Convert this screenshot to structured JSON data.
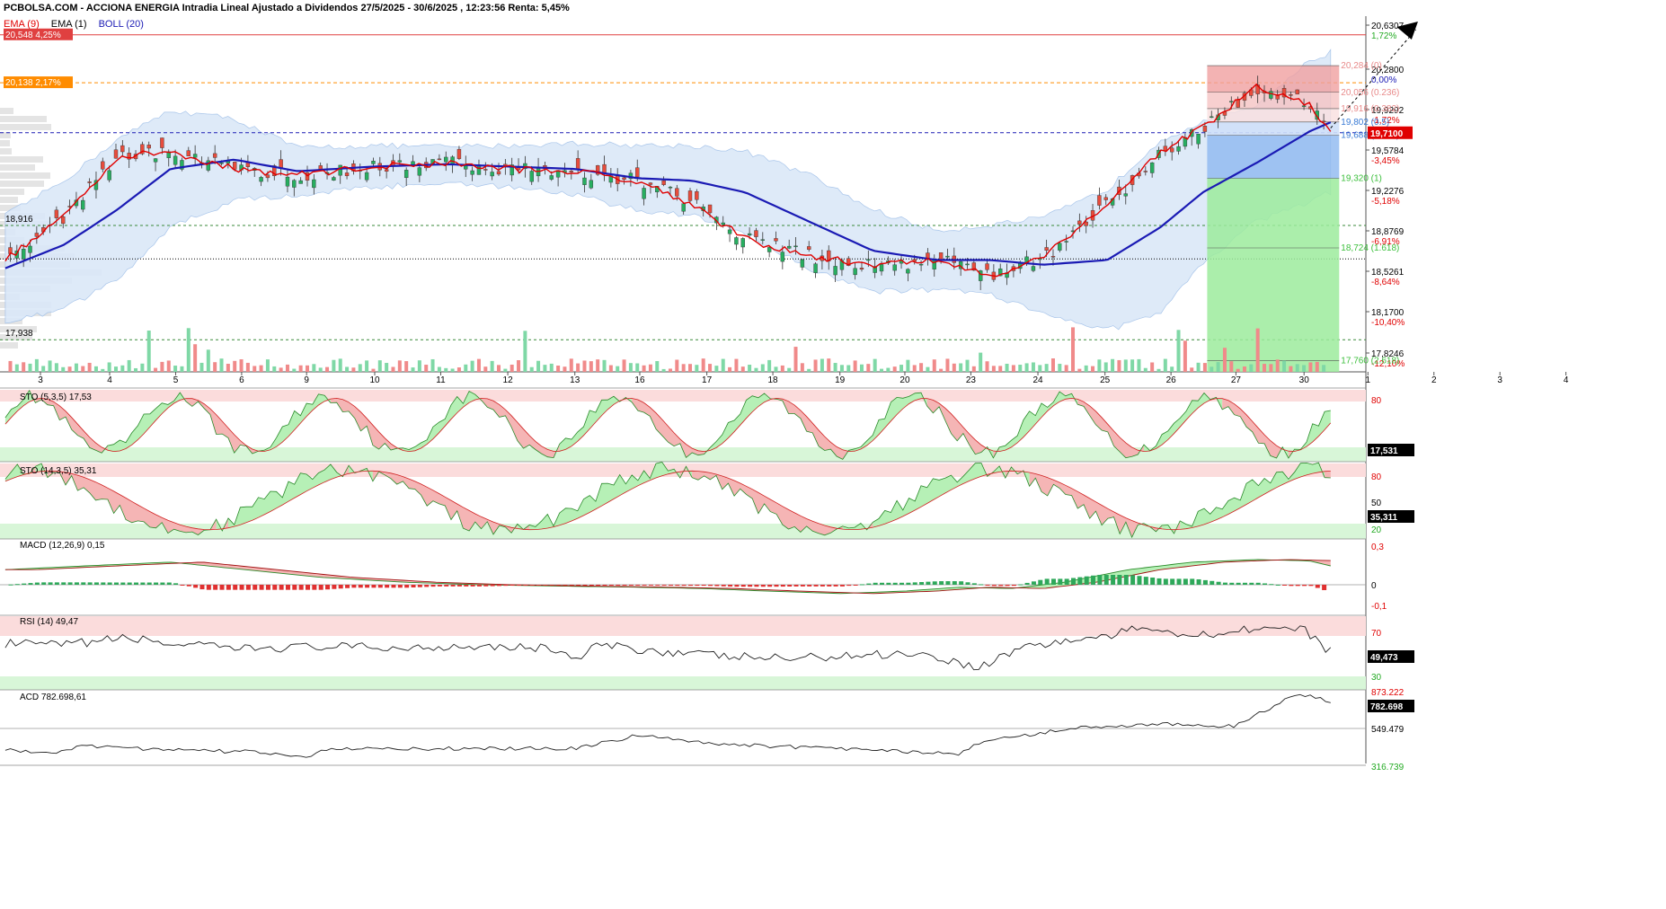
{
  "header": {
    "title": "PCBOLSA.COM - ACCIONA ENERGIA Intradia Lineal Ajustado a Dividendos 27/5/2025 - 30/6/2025 , 12:23:56 Renta: 5,45%"
  },
  "legend": {
    "ema9": "EMA (9)",
    "ema1": "EMA (1)",
    "boll": "BOLL (20)"
  },
  "colors": {
    "ema9": "#e00000",
    "ema20": "#1a1ab4",
    "boll_fill": "#dbe8f8",
    "up_candle": "#27ae60",
    "down_candle": "#e74c3c",
    "fib_red": "#e88a8a",
    "fib_green": "#5ec85e",
    "fib_blue": "#3a7bd5"
  },
  "price_axis": {
    "ticks": [
      {
        "price": "20,6307",
        "pct": "1,72%",
        "pct_color": "#22aa22"
      },
      {
        "price": "20,2800",
        "pct": "0,00%",
        "pct_color": "#1a1ab4"
      },
      {
        "price": "19,9292",
        "pct": "-1,72%",
        "pct_color": "#e00000"
      },
      {
        "price": "19,5784",
        "pct": "-3,45%",
        "pct_color": "#e00000"
      },
      {
        "price": "19,2276",
        "pct": "-5,18%",
        "pct_color": "#e00000"
      },
      {
        "price": "18,8769",
        "pct": "-6,91%",
        "pct_color": "#e00000"
      },
      {
        "price": "18,5261",
        "pct": "-8,64%",
        "pct_color": "#e00000"
      },
      {
        "price": "18,1700",
        "pct": "-10,40%",
        "pct_color": "#e00000"
      },
      {
        "price": "17,8246",
        "pct": "-12,10%",
        "pct_color": "#e00000"
      }
    ],
    "current_price": "19,7100"
  },
  "x_axis": {
    "labels": [
      "3",
      "4",
      "5",
      "6",
      "9",
      "10",
      "11",
      "12",
      "13",
      "16",
      "17",
      "18",
      "19",
      "20",
      "23",
      "24",
      "25",
      "26",
      "27",
      "30",
      "1",
      "2",
      "3",
      "4"
    ]
  },
  "price_labels": {
    "top_line": "20,548",
    "top_line_pct": "4,25%",
    "orange_line": "20,138",
    "orange_line_pct": "2,17%",
    "left_18916": "18,916",
    "left_17938": "17,938"
  },
  "fibonacci": [
    {
      "label": "20,284 (0)",
      "color": "#e88a8a"
    },
    {
      "label": "20,056 (0.236)",
      "color": "#e88a8a"
    },
    {
      "label": "19,916 (0.382)",
      "color": "#e88a8a"
    },
    {
      "label": "19,802 (0.5)",
      "color": "#3a7bd5"
    },
    {
      "label": "19,688 (0.618)",
      "color": "#3a7bd5"
    },
    {
      "label": "19,320 (1)",
      "color": "#3cbf3c"
    },
    {
      "label": "18,724 (1.618)",
      "color": "#3cbf3c"
    },
    {
      "label": "17,760 (2.618)",
      "color": "#3cbf3c"
    }
  ],
  "panels": {
    "sto1": {
      "label": "STO (5,3,5)",
      "value": "17,53",
      "badge": "17,531",
      "levels": [
        "80",
        "20"
      ]
    },
    "sto2": {
      "label": "STO (14,3,5)",
      "value": "35,31",
      "badge": "35,311",
      "levels": [
        "80",
        "50",
        "20"
      ]
    },
    "macd": {
      "label": "MACD (12,26,9)",
      "value": "0,15",
      "levels": [
        "0,3",
        "0",
        "-0,1"
      ]
    },
    "rsi": {
      "label": "RSI (14)",
      "value": "49,47",
      "badge": "49,473",
      "levels": [
        "70",
        "30"
      ]
    },
    "acd": {
      "label": "ACD",
      "value": "782.698,61",
      "badge": "782.698",
      "levels": [
        "549.479"
      ],
      "top_partial": "873.222",
      "bottom_partial": "316.739"
    }
  },
  "chart_data": {
    "type": "line",
    "title": "PCBOLSA.COM - ACCIONA ENERGIA Intradia Lineal Ajustado a Dividendos 27/5/2025 - 30/6/2025 , 12:23:56 Renta: 5,45%",
    "x": [
      "3",
      "4",
      "5",
      "6",
      "9",
      "10",
      "11",
      "12",
      "13",
      "16",
      "17",
      "18",
      "19",
      "20",
      "23",
      "24",
      "25",
      "26",
      "27",
      "30"
    ],
    "series": [
      {
        "name": "EMA (9)",
        "values": [
          18.62,
          19.45,
          19.55,
          19.45,
          19.38,
          19.42,
          19.45,
          19.4,
          19.3,
          19.35,
          19.05,
          18.75,
          18.6,
          18.62,
          18.45,
          18.7,
          19.05,
          19.5,
          19.95,
          19.71
        ]
      },
      {
        "name": "BOLL (20)",
        "values": [
          18.55,
          19.05,
          19.45,
          19.48,
          19.42,
          19.42,
          19.44,
          19.42,
          19.35,
          19.32,
          19.2,
          18.95,
          18.7,
          18.62,
          18.62,
          18.6,
          18.7,
          19.05,
          19.5,
          19.8
        ]
      }
    ],
    "ylim": [
      17.7,
      20.75
    ],
    "last_price": 19.71
  }
}
